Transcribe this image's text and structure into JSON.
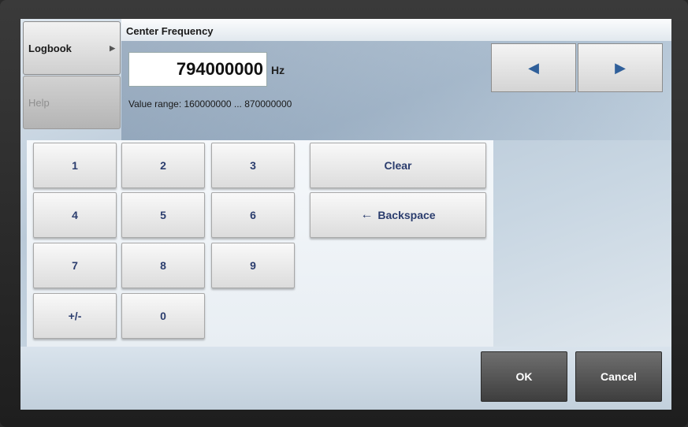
{
  "side_menu": {
    "logbook_label": "Logbook",
    "help_label": "Help"
  },
  "dialog": {
    "title": "Center Frequency",
    "value": "794000000",
    "unit": "Hz",
    "range_text": "Value range: 160000000 ... 870000000"
  },
  "nav": {
    "prev_icon": "◀",
    "next_icon": "▶"
  },
  "keypad": {
    "keys": [
      "1",
      "2",
      "3",
      "4",
      "5",
      "6",
      "7",
      "8",
      "9",
      "+/-",
      "0"
    ],
    "clear_label": "Clear",
    "backspace_label": "Backspace",
    "backspace_icon": "←"
  },
  "actions": {
    "ok_label": "OK",
    "cancel_label": "Cancel"
  },
  "colors": {
    "key_text": "#2b3d6e",
    "arrow": "#2f5f9a"
  }
}
